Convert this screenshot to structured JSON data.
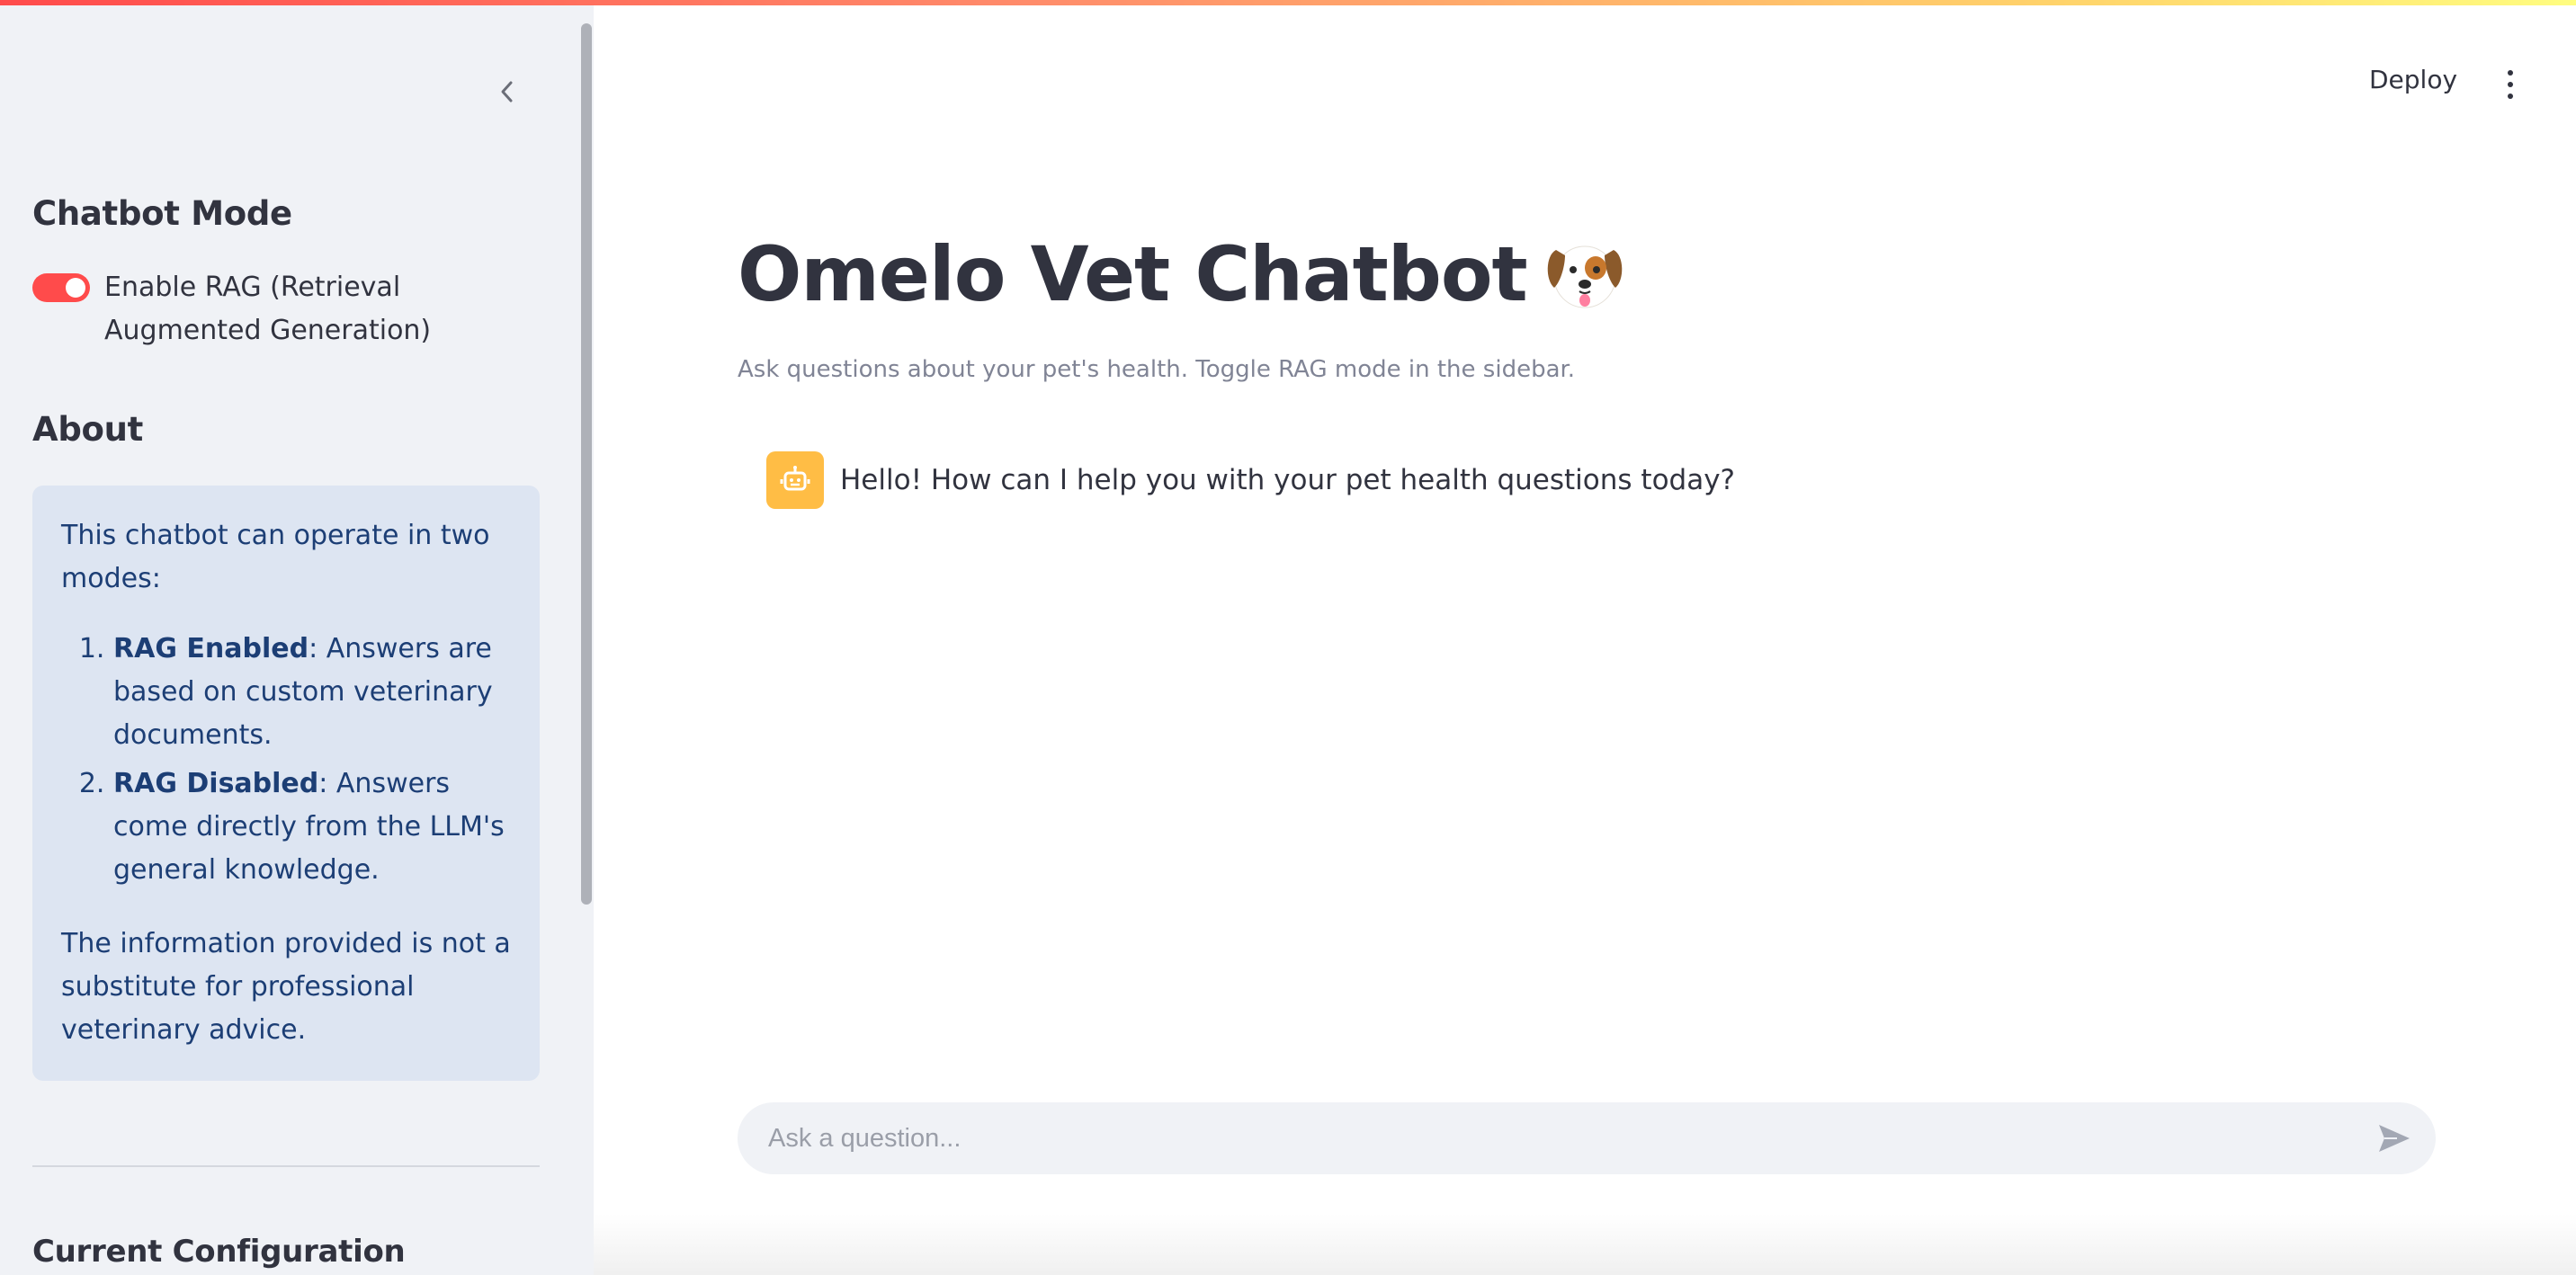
{
  "sidebar": {
    "collapse_icon": "chevron-left-icon",
    "chatbot_mode_heading": "Chatbot Mode",
    "rag_toggle": {
      "label": "Enable RAG (Retrieval Augmented Generation)",
      "enabled": true
    },
    "about_heading": "About",
    "about": {
      "intro": "This chatbot can operate in two modes:",
      "items": [
        {
          "bold": "RAG Enabled",
          "text": ": Answers are based on custom veterinary documents."
        },
        {
          "bold": "RAG Disabled",
          "text": ": Answers come directly from the LLM's general knowledge."
        }
      ],
      "disclaimer": "The information provided is not a substitute for professional veterinary advice."
    },
    "config_heading": "Current Configuration"
  },
  "header": {
    "deploy_label": "Deploy",
    "menu_icon": "more-vertical-icon"
  },
  "main": {
    "title": "Omelo Vet Chatbot",
    "title_emoji": "dog-face-emoji",
    "subtitle": "Ask questions about your pet's health. Toggle RAG mode in the sidebar.",
    "messages": [
      {
        "role": "assistant",
        "avatar_icon": "robot-icon",
        "text": "Hello! How can I help you with your pet health questions today?"
      }
    ],
    "input": {
      "placeholder": "Ask a question...",
      "value": ""
    },
    "send_icon": "send-icon"
  },
  "colors": {
    "accent": "#ff4b4b",
    "sidebar_bg": "#f0f2f6",
    "info_bg": "#dde5f2",
    "info_text": "#1c3e75",
    "avatar_bg": "#ffbd45"
  }
}
